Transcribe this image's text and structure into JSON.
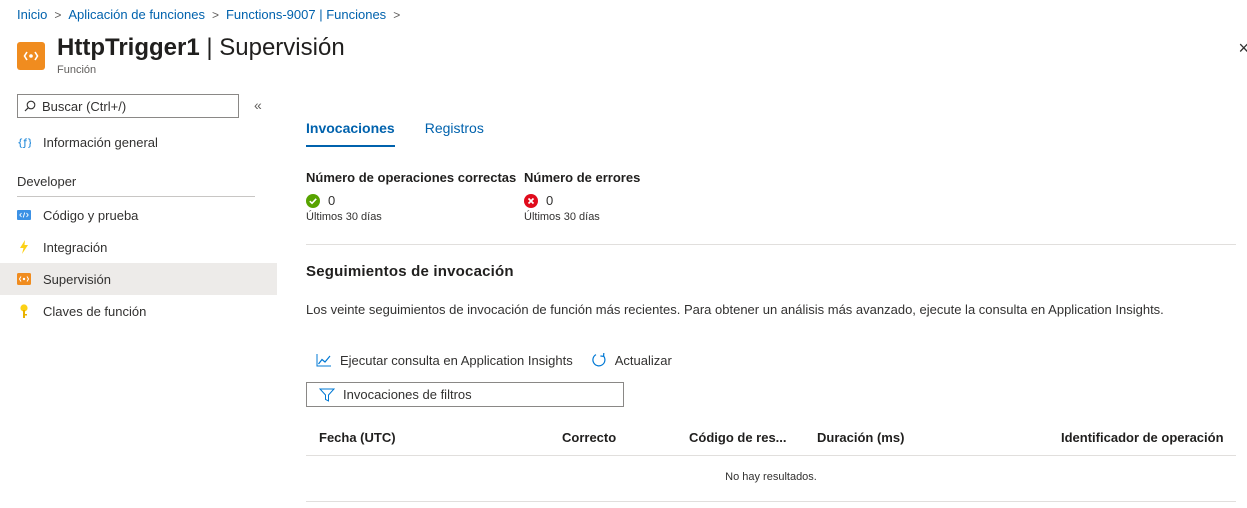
{
  "breadcrumb": {
    "items": [
      "Inicio",
      "Aplicación de funciones",
      "Functions-9007 | Funciones"
    ],
    "separator": ">"
  },
  "header": {
    "title_bold": "HttpTrigger1",
    "title_rest": " | Supervisión",
    "subtitle": "Función",
    "close_icon": "×"
  },
  "sidebar": {
    "search_placeholder": "Buscar (Ctrl+/)",
    "collapse_icon": "«",
    "overview": "Información general",
    "section": "Developer",
    "items": [
      {
        "label": "Código y prueba",
        "icon": "code-icon"
      },
      {
        "label": "Integración",
        "icon": "lightning-icon"
      },
      {
        "label": "Supervisión",
        "icon": "monitor-icon",
        "active": true
      },
      {
        "label": "Claves de función",
        "icon": "key-icon"
      }
    ]
  },
  "tabs": [
    {
      "label": "Invocaciones",
      "active": true
    },
    {
      "label": "Registros",
      "active": false
    }
  ],
  "metrics": [
    {
      "title": "Número de operaciones correctas",
      "value": "0",
      "sub": "Últimos 30 días",
      "status": "success"
    },
    {
      "title": "Número de errores",
      "value": "0",
      "sub": "Últimos 30 días",
      "status": "error"
    }
  ],
  "traces": {
    "title": "Seguimientos de invocación",
    "description": "Los veinte seguimientos de invocación de función más recientes. Para obtener un análisis más avanzado, ejecute la consulta en Application Insights.",
    "run_query": "Ejecutar consulta en Application Insights",
    "refresh": "Actualizar",
    "filter": "Invocaciones de filtros",
    "columns": [
      "Fecha (UTC)",
      "Correcto",
      "Código de res...",
      "Duración (ms)",
      "Identificador de operación"
    ],
    "empty": "No hay resultados."
  },
  "colors": {
    "accent": "#0062ad",
    "function_orange": "#f08c1f",
    "success": "#57a300",
    "error": "#e00b1c"
  }
}
